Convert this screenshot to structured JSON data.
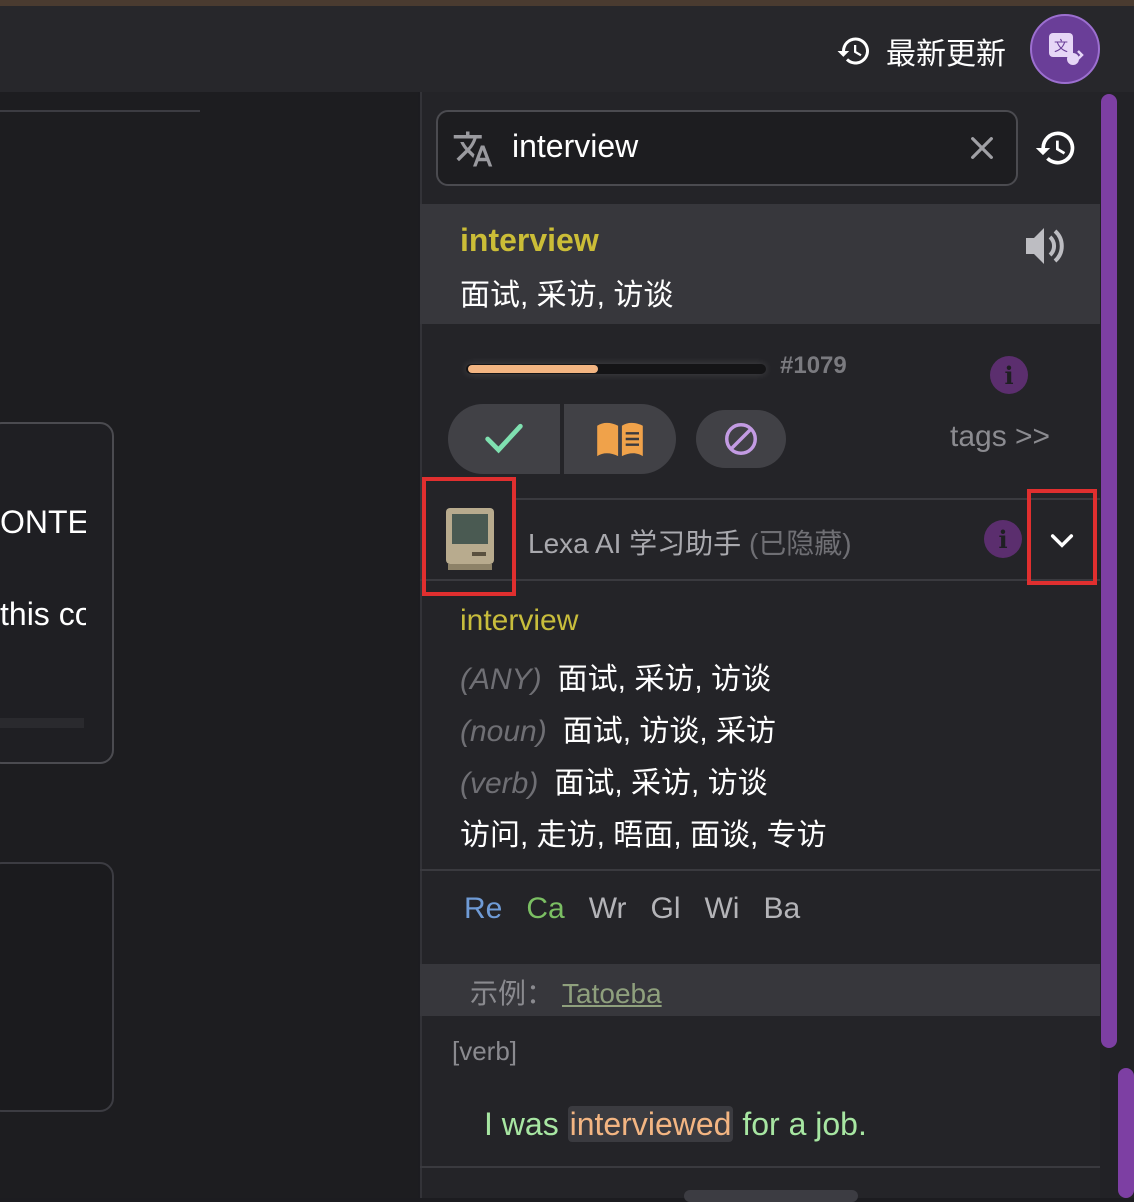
{
  "header": {
    "recent_label": "最新更新",
    "recent_icon": "history-icon",
    "avatar_icon": "translate-voice-icon"
  },
  "left": {
    "card_text_1": "ONTEX",
    "card_text_2": "this co"
  },
  "search": {
    "value": "interview",
    "icon": "translate-icon",
    "clear_icon": "close-icon",
    "history_icon": "history-icon"
  },
  "word": {
    "headword": "interview",
    "translation": "面试, 采访, 访谈",
    "rank": "#1079",
    "progress_fraction": 0.44
  },
  "actions": {
    "tags_label": "tags >>"
  },
  "assistant": {
    "name": "Lexa AI 学习助手",
    "hidden_label": "(已隐藏)"
  },
  "definition": {
    "word": "interview",
    "lines": [
      {
        "pos": "(ANY)",
        "text": "面试, 采访, 访谈"
      },
      {
        "pos": "(noun)",
        "text": "面试, 访谈, 采访"
      },
      {
        "pos": "(verb)",
        "text": "面试, 采访, 访谈"
      }
    ],
    "synonyms": "访问, 走访, 晤面, 面谈, 专访"
  },
  "dict_tabs": [
    {
      "label": "Re",
      "color": "#6f9bd6"
    },
    {
      "label": "Ca",
      "color": "#7bbf63"
    },
    {
      "label": "Wr",
      "color": "#b4b4b8"
    },
    {
      "label": "Gl",
      "color": "#b4b4b8"
    },
    {
      "label": "Wi",
      "color": "#b4b4b8"
    },
    {
      "label": "Ba",
      "color": "#b4b4b8"
    }
  ],
  "examples": {
    "label": "示例：",
    "source": "Tatoeba",
    "pos_tag": "[verb]",
    "sentence_before": "I was ",
    "sentence_highlight": "interviewed",
    "sentence_after": " for a job."
  },
  "colors": {
    "accent": "#7d3fa3",
    "headword": "#cbbd37",
    "highlight": "#f3b582"
  }
}
